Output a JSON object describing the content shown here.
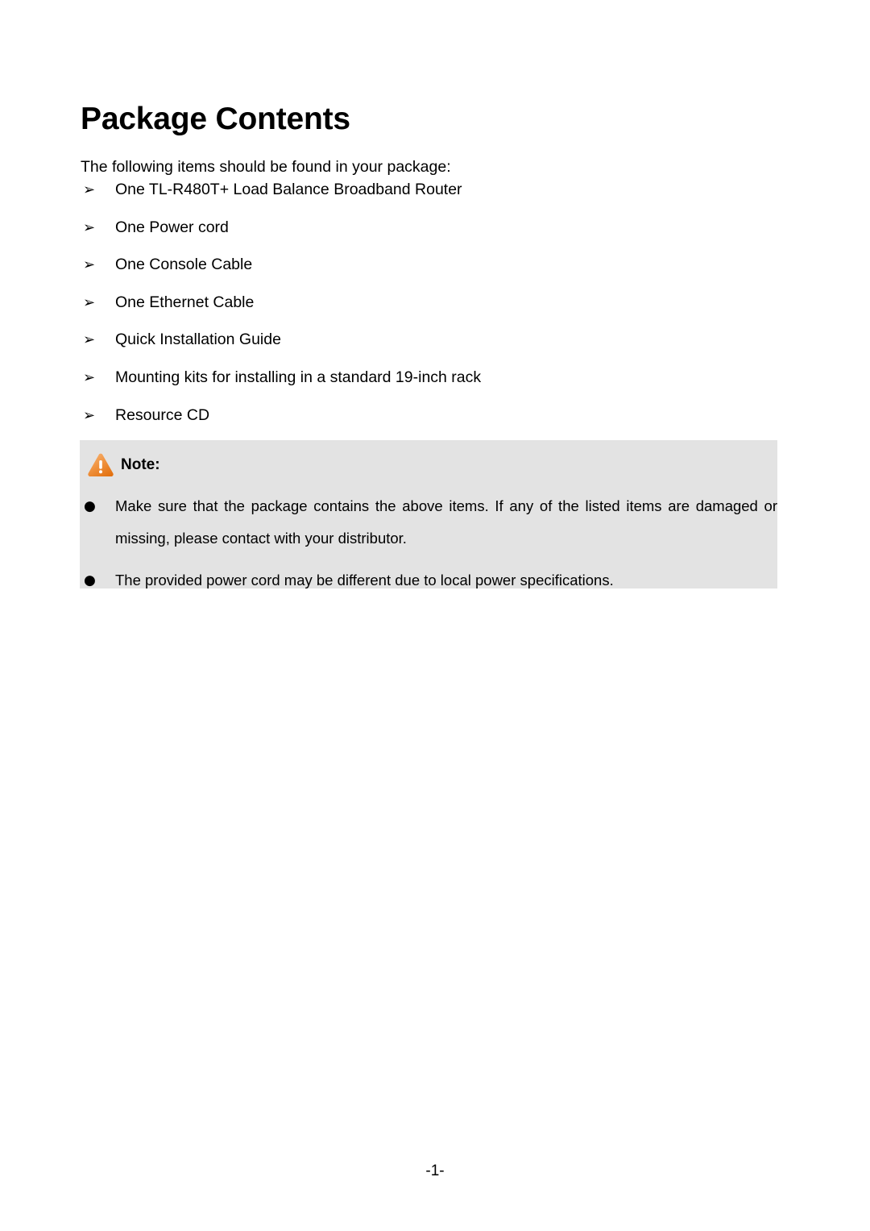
{
  "document": {
    "title": "Package Contents",
    "intro": "The following items should be found in your package:",
    "page_number": "-1-"
  },
  "package_items": {
    "marker": "➢",
    "entries": [
      "One TL-R480T+ Load Balance Broadband Router",
      "One Power cord",
      "One Console Cable",
      "One Ethernet Cable",
      "Quick Installation Guide",
      "Mounting kits for installing in a standard 19-inch rack",
      "Resource CD"
    ]
  },
  "note": {
    "label": "Note:",
    "icon": "warning-triangle-icon",
    "background_color": "#e3e3e3",
    "icon_color_light": "#f5a95e",
    "icon_color_dark": "#e06a16",
    "marker": "●",
    "items": [
      "Make sure that the package contains the above items. If any of the listed items are damaged or missing, please contact with your distributor.",
      "The provided power cord may be different due to local power specifications."
    ]
  }
}
